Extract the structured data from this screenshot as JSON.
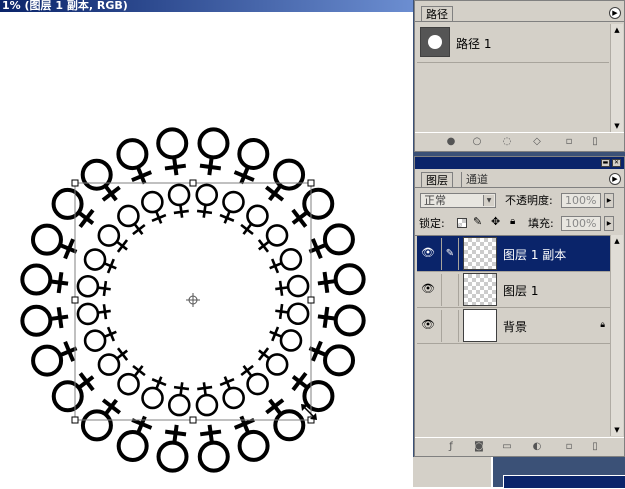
{
  "document": {
    "title": "1% (图层 1 副本, RGB)"
  },
  "paths_panel": {
    "tab_label": "路径",
    "items": [
      {
        "name": "路径 1"
      }
    ],
    "footer_icons": [
      "fill-path-icon",
      "stroke-path-icon",
      "load-selection-icon",
      "make-work-path-icon",
      "new-path-icon",
      "delete-path-icon"
    ]
  },
  "layers_panel": {
    "tabs": [
      "图层",
      "通道"
    ],
    "blend_mode": "正常",
    "opacity_label": "不透明度:",
    "opacity_value": "100%",
    "lock_label": "锁定:",
    "fill_label": "填充:",
    "fill_value": "100%",
    "layers": [
      {
        "name": "图层 1 副本",
        "selected": true,
        "visible": true,
        "transparent": true,
        "locked": false
      },
      {
        "name": "图层 1",
        "selected": false,
        "visible": true,
        "transparent": true,
        "locked": false
      },
      {
        "name": "背景",
        "selected": false,
        "visible": true,
        "transparent": false,
        "locked": true
      }
    ],
    "footer_icons": [
      "link-icon",
      "layer-style-icon",
      "mask-icon",
      "new-set-icon",
      "adjustment-layer-icon",
      "new-layer-icon",
      "delete-layer-icon"
    ]
  },
  "artwork": {
    "stroke_color": "#000000",
    "selection_color": "#808080"
  }
}
